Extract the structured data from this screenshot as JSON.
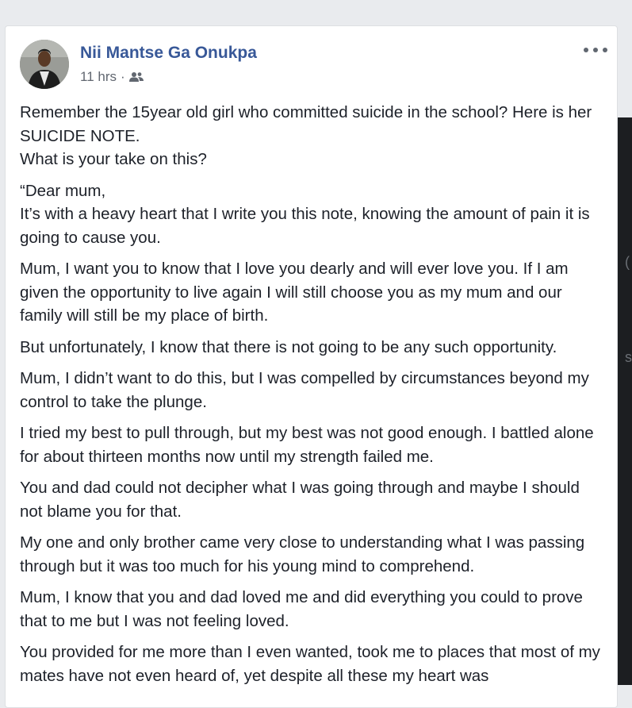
{
  "post": {
    "author": "Nii Mantse Ga Onukpa",
    "time": "11 hrs",
    "separator": "·",
    "audience_icon": "friends-icon",
    "more_icon": "more-options-icon",
    "paragraphs": [
      "Remember the 15year old girl who committed suicide in the school? Here is her SUICIDE NOTE.\nWhat is your take on this?",
      "“Dear mum,\nIt’s with a heavy heart that I write you this note, knowing the amount of pain it is going to cause you.",
      "Mum, I want you to know that I love you dearly and will ever love you. If I am given the opportunity to live again I will still choose you as my mum and our family will still be my place of birth.",
      "But unfortunately, I know that there is not going to be any such opportunity.",
      "Mum, I didn’t want to do this, but I was compelled by circumstances beyond my control to take the plunge.",
      "I tried my best to pull through, but my best was not good enough. I battled alone for about thirteen months now until my strength failed me.",
      "You and dad could not decipher what I was going through and maybe I should not blame you for that.",
      "My one and only brother came very close to understanding what I was passing through but it was too much for his young mind to comprehend.",
      "Mum, I know that you and dad loved me and did everything you could to prove that to me but I was not feeling loved.",
      "You provided for me more than I even wanted, took me to places that most of my mates have not even heard of, yet despite all these my heart was"
    ]
  },
  "colors": {
    "author": "#385898",
    "text": "#1d2129",
    "meta": "#616770",
    "page_bg": "#e9ebee"
  }
}
